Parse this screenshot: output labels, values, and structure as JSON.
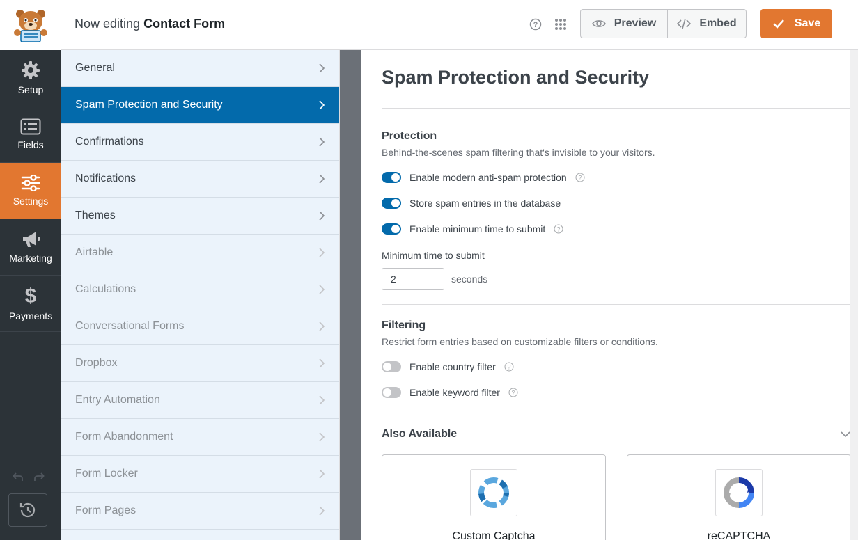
{
  "header": {
    "editing_prefix": "Now editing",
    "form_name": "Contact Form",
    "preview_label": "Preview",
    "embed_label": "Embed",
    "save_label": "Save"
  },
  "iconbar": {
    "items": [
      {
        "label": "Setup",
        "icon": "gear-icon"
      },
      {
        "label": "Fields",
        "icon": "list-icon"
      },
      {
        "label": "Settings",
        "icon": "sliders-icon",
        "active": true
      },
      {
        "label": "Marketing",
        "icon": "megaphone-icon"
      },
      {
        "label": "Payments",
        "icon": "dollar-icon"
      }
    ]
  },
  "panel": {
    "items": [
      {
        "label": "General",
        "state": "normal"
      },
      {
        "label": "Spam Protection and Security",
        "state": "active"
      },
      {
        "label": "Confirmations",
        "state": "normal"
      },
      {
        "label": "Notifications",
        "state": "normal"
      },
      {
        "label": "Themes",
        "state": "normal"
      },
      {
        "label": "Airtable",
        "state": "disabled"
      },
      {
        "label": "Calculations",
        "state": "disabled"
      },
      {
        "label": "Conversational Forms",
        "state": "disabled"
      },
      {
        "label": "Dropbox",
        "state": "disabled"
      },
      {
        "label": "Entry Automation",
        "state": "disabled"
      },
      {
        "label": "Form Abandonment",
        "state": "disabled"
      },
      {
        "label": "Form Locker",
        "state": "disabled"
      },
      {
        "label": "Form Pages",
        "state": "disabled"
      }
    ]
  },
  "content": {
    "title": "Spam Protection and Security",
    "protection": {
      "title": "Protection",
      "desc": "Behind-the-scenes spam filtering that's invisible to your visitors.",
      "toggles": [
        {
          "label": "Enable modern anti-spam protection",
          "on": true,
          "help": true
        },
        {
          "label": "Store spam entries in the database",
          "on": true,
          "help": false
        },
        {
          "label": "Enable minimum time to submit",
          "on": true,
          "help": true
        }
      ],
      "min_time_label": "Minimum time to submit",
      "min_time_value": "2",
      "min_time_unit": "seconds"
    },
    "filtering": {
      "title": "Filtering",
      "desc": "Restrict form entries based on customizable filters or conditions.",
      "toggles": [
        {
          "label": "Enable country filter",
          "on": false,
          "help": true
        },
        {
          "label": "Enable keyword filter",
          "on": false,
          "help": true
        }
      ]
    },
    "also_available": {
      "title": "Also Available",
      "cards": [
        {
          "name": "Custom Captcha"
        },
        {
          "name": "reCAPTCHA"
        }
      ]
    }
  },
  "colors": {
    "accent": "#e27730",
    "primary": "#036aab",
    "sidebar": "#2c3338"
  }
}
